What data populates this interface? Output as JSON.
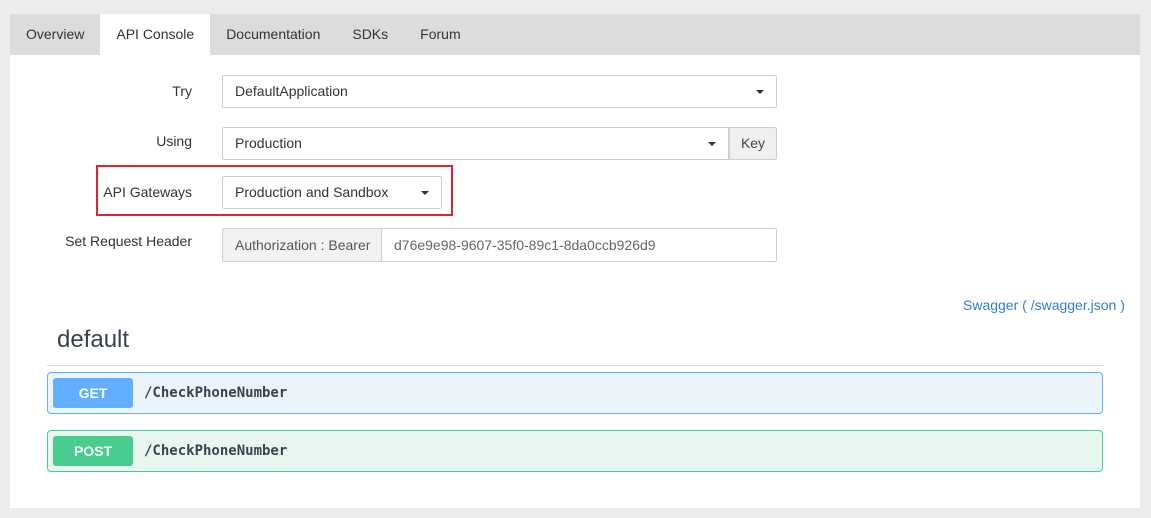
{
  "tabs": [
    "Overview",
    "API Console",
    "Documentation",
    "SDKs",
    "Forum"
  ],
  "active_tab": "API Console",
  "form": {
    "try_label": "Try",
    "try_value": "DefaultApplication",
    "using_label": "Using",
    "using_value": "Production",
    "key_button": "Key",
    "gateways_label": "API Gateways",
    "gateways_value": "Production and Sandbox",
    "header_label": "Set Request Header",
    "auth_prefix": "Authorization : Bearer",
    "auth_token": "d76e9e98-9607-35f0-89c1-8da0ccb926d9"
  },
  "swagger_link": "Swagger ( /swagger.json )",
  "section": {
    "title": "default",
    "operations": [
      {
        "method": "GET",
        "path": "/CheckPhoneNumber"
      },
      {
        "method": "POST",
        "path": "/CheckPhoneNumber"
      }
    ]
  },
  "colors": {
    "highlight": "#d9272e",
    "get": "#61affe",
    "post": "#49cc90",
    "link": "#2f7fd1"
  }
}
